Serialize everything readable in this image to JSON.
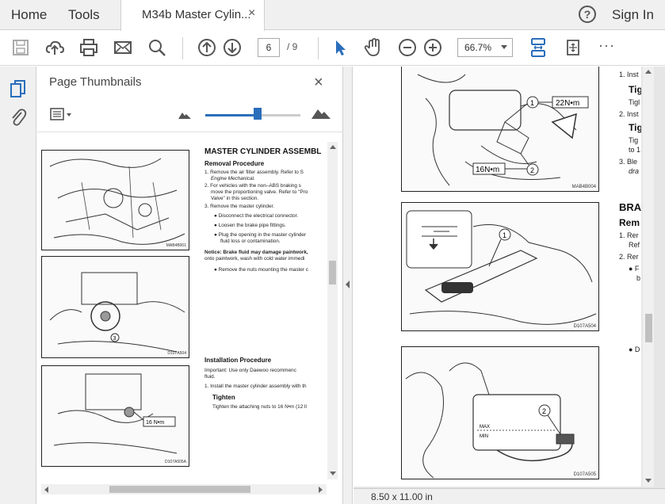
{
  "menubar": {
    "home": "Home",
    "tools": "Tools",
    "tab_title": "M34b Master Cylin...",
    "tab_close": "×",
    "help": "?",
    "sign_in": "Sign In"
  },
  "toolbar": {
    "page_current": "6",
    "page_total": "/ 9",
    "zoom": "66.7%",
    "more": "···"
  },
  "thumbnails": {
    "title": "Page Thumbnails",
    "close": "×",
    "zoom_slider_level": 0.55,
    "heading": "MASTER CYLINDER ASSEMBL",
    "removal_title": "Removal Procedure",
    "removal_lines": [
      "1. Remove the air filter assembly. Refer to S",
      "Engine Mechanical.",
      "2. For vehicles with the non–ABS braking s",
      "move the proportioning valve. Refer to \"Pro",
      "Valve\" in this section.",
      "3. Remove the master cylinder.",
      "● Disconnect the electrical connector.",
      "● Loosen the brake pipe fittings.",
      "● Plug the opening in the master cylinder",
      "fluid loss or contamination."
    ],
    "notice": "Notice: Brake fluid may damage paintwork,",
    "notice_cont": "onto paintwork, wash with cold water immedi",
    "notice_bullet": "● Remove the nuts mounting the master c",
    "install_title": "Installation Procedure",
    "install_important": "Important: Use only Daewoo recommenc",
    "install_important_cont": "fluid.",
    "install_step": "1. Install the master cylinder assembly with th",
    "tighten_title": "Tighten",
    "tighten_text": "Tighten the attaching nuts to 16 N•m (12 ll",
    "fig1_id": "MAB4B001",
    "fig2_id": "D107A504",
    "fig3_id": "D107A505A",
    "fig3_callout": "16 N•m",
    "fig2_callout": "3"
  },
  "document": {
    "page_size": "8.50 x 11.00 in",
    "fig_top_callout_1": "22N•m",
    "fig_top_callout_2": "16N•m",
    "fig_top_id": "MAB4B004",
    "fig_mid_id": "D107A504",
    "fig_bot_id": "D107A505",
    "fig_bot_max": "MAX",
    "fig_bot_min": "MIN",
    "num_1": "1",
    "num_2": "2",
    "right_lines": [
      "1. Inst",
      "Tig",
      "Tigl",
      "2. Inst",
      "Tig",
      "Tig",
      "to 1",
      "3. Ble",
      "dra",
      "BRA",
      "Rem",
      "1. Rer",
      "Ref",
      "2. Rer",
      "● F",
      "b",
      "● D"
    ]
  }
}
